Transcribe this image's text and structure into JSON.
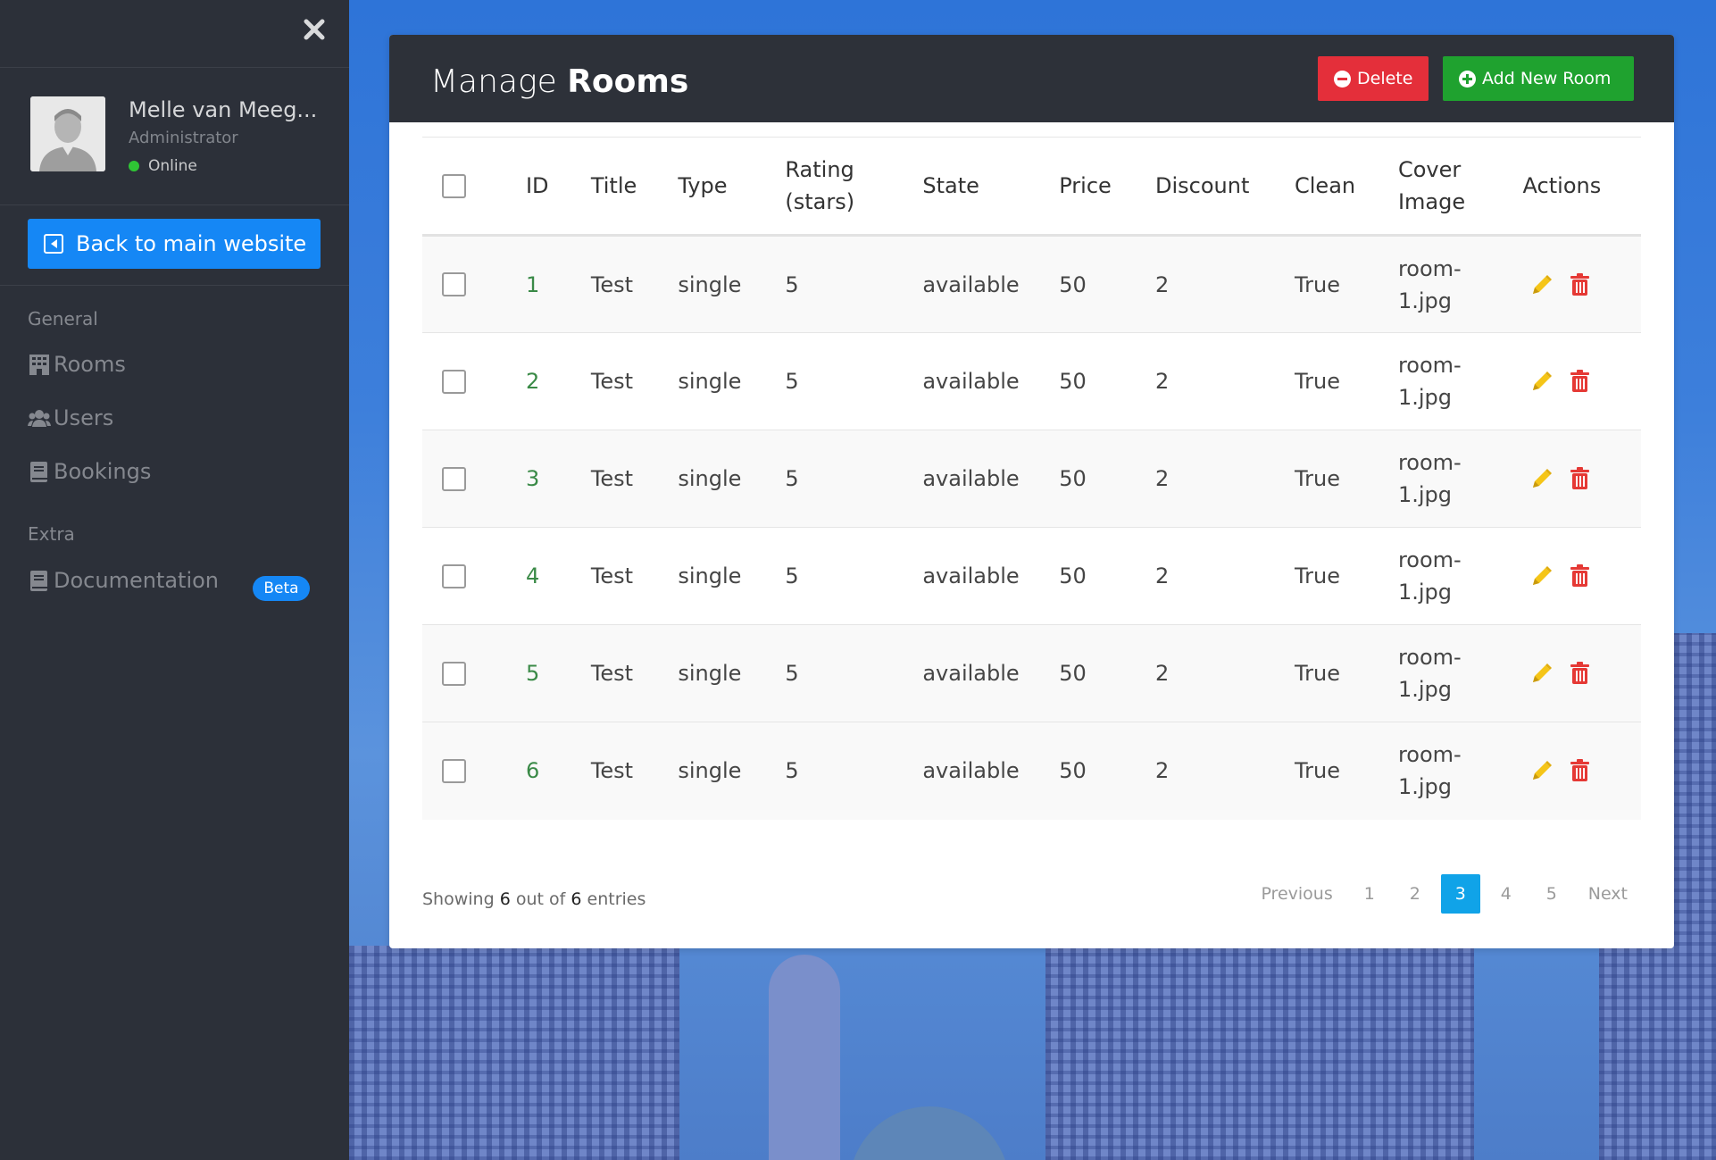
{
  "sidebar": {
    "user": {
      "name": "Melle van Meeg...",
      "role": "Administrator",
      "status": "Online"
    },
    "back_button": "Back to main website",
    "sections": [
      {
        "label": "General"
      },
      {
        "label": "Extra"
      }
    ],
    "nav": {
      "rooms": "Rooms",
      "users": "Users",
      "bookings": "Bookings",
      "documentation": "Documentation",
      "documentation_badge": "Beta"
    }
  },
  "header": {
    "title_light": "Manage",
    "title_bold": "Rooms",
    "delete_label": "Delete",
    "add_label": "Add New Room"
  },
  "table": {
    "columns": {
      "id": "ID",
      "title": "Title",
      "type": "Type",
      "rating": "Rating (stars)",
      "state": "State",
      "price": "Price",
      "discount": "Discount",
      "clean": "Clean",
      "cover": "Cover Image",
      "actions": "Actions"
    },
    "rows": [
      {
        "id": "1",
        "title": "Test",
        "type": "single",
        "rating": "5",
        "state": "available",
        "price": "50",
        "discount": "2",
        "clean": "True",
        "cover": "room-1.jpg"
      },
      {
        "id": "2",
        "title": "Test",
        "type": "single",
        "rating": "5",
        "state": "available",
        "price": "50",
        "discount": "2",
        "clean": "True",
        "cover": "room-1.jpg"
      },
      {
        "id": "3",
        "title": "Test",
        "type": "single",
        "rating": "5",
        "state": "available",
        "price": "50",
        "discount": "2",
        "clean": "True",
        "cover": "room-1.jpg"
      },
      {
        "id": "4",
        "title": "Test",
        "type": "single",
        "rating": "5",
        "state": "available",
        "price": "50",
        "discount": "2",
        "clean": "True",
        "cover": "room-1.jpg"
      },
      {
        "id": "5",
        "title": "Test",
        "type": "single",
        "rating": "5",
        "state": "available",
        "price": "50",
        "discount": "2",
        "clean": "True",
        "cover": "room-1.jpg"
      },
      {
        "id": "6",
        "title": "Test",
        "type": "single",
        "rating": "5",
        "state": "available",
        "price": "50",
        "discount": "2",
        "clean": "True",
        "cover": "room-1.jpg"
      }
    ]
  },
  "footer": {
    "showing_prefix": "Showing",
    "showing_count": "6",
    "showing_mid": "out of",
    "showing_total": "6",
    "showing_suffix": "entries",
    "pagination": {
      "previous": "Previous",
      "pages": [
        "1",
        "2",
        "3",
        "4",
        "5"
      ],
      "active_page": "3",
      "next": "Next"
    }
  },
  "colors": {
    "sidebar_bg": "#2c3039",
    "accent_blue": "#1587f5",
    "delete_red": "#e42f3a",
    "add_green": "#1fa22f",
    "edit_yellow": "#f5c518",
    "trash_red": "#e53935",
    "active_page": "#10a3e8"
  },
  "icons": {
    "close": "close-icon",
    "rooms": "building-icon",
    "users": "users-icon",
    "bookings": "book-icon",
    "documentation": "book-icon",
    "edit": "pencil-icon",
    "delete_row": "trash-icon"
  }
}
